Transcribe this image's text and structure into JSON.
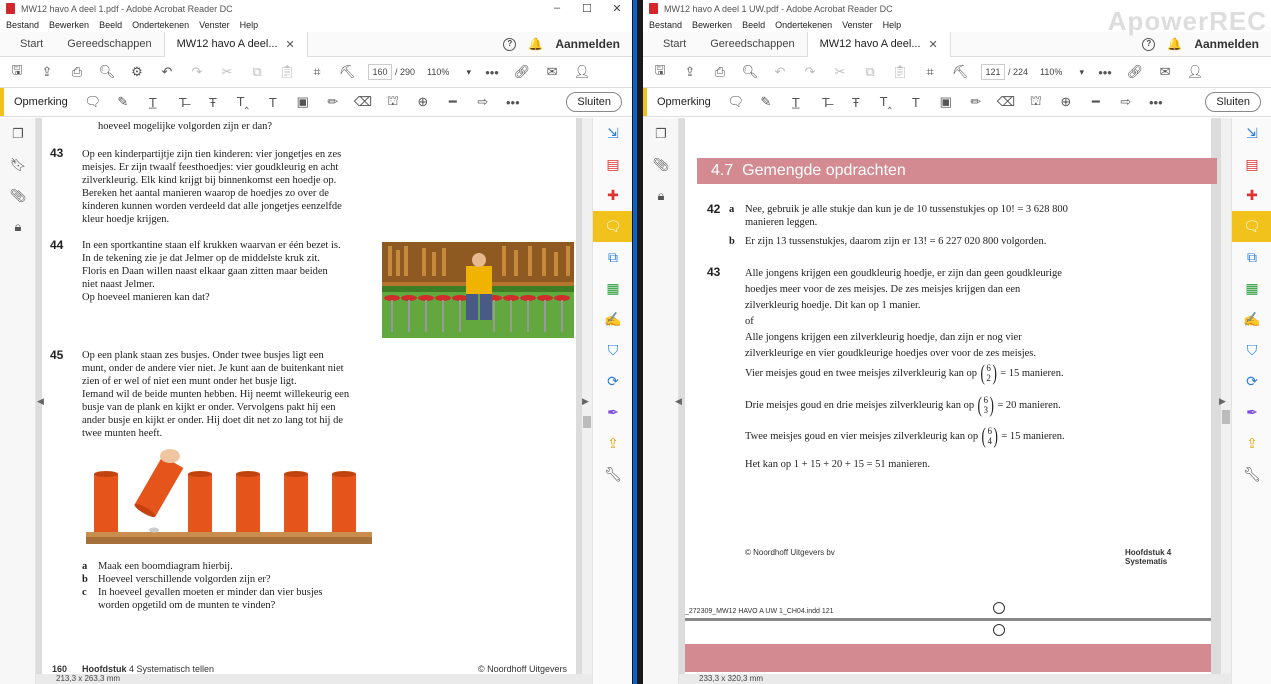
{
  "left": {
    "title": "MW12 havo A deel 1.pdf - Adobe Acrobat Reader DC",
    "menu": [
      "Bestand",
      "Bewerken",
      "Beeld",
      "Ondertekenen",
      "Venster",
      "Help"
    ],
    "tabs": {
      "start": "Start",
      "tools": "Gereedschappen",
      "doc": "MW12 havo A deel..."
    },
    "signin": "Aanmelden",
    "page_current": "160",
    "page_total": "/ 290",
    "zoom": "110%",
    "comment_label": "Opmerking",
    "close_label": "Sluiten",
    "status_size": "213,3 x 263,3 mm",
    "content": {
      "top_cut": "hoeveel mogelijke volgorden zijn er dan?",
      "ex43_num": "43",
      "ex43_lines": [
        "Op een kinderpartijtje zijn tien kinderen: vier jongetjes en zes",
        "meisjes. Er zijn twaalf feesthoedjes: vier goudkleurig en acht",
        "zilverkleurig. Elk kind krijgt bij binnenkomst een hoedje op.",
        "Bereken het aantal manieren waarop de hoedjes zo over de",
        "kinderen kunnen worden verdeeld dat alle jongetjes eenzelfde",
        "kleur hoedje krijgen."
      ],
      "ex44_num": "44",
      "ex44_lines": [
        "In een sportkantine staan elf krukken waarvan er één bezet is.",
        "In de tekening zie je dat Jelmer op de middelste kruk zit.",
        "Floris en Daan willen naast elkaar gaan zitten maar beiden",
        "niet naast Jelmer.",
        "Op hoeveel manieren kan dat?"
      ],
      "ex45_num": "45",
      "ex45_lines": [
        "Op een plank staan zes busjes. Onder twee busjes ligt een",
        "munt, onder de andere vier niet. Je kunt aan de buitenkant niet",
        "zien of er wel of niet een munt onder het busje ligt.",
        "Iemand wil de beide munten hebben. Hij neemt willekeurig een",
        "busje van de plank en kijkt er onder. Vervolgens pakt hij een",
        "ander busje en kijkt er onder. Hij doet dit net zo lang tot hij de",
        "twee munten heeft."
      ],
      "sub_a_letter": "a",
      "sub_a": "Maak een boomdiagram hierbij.",
      "sub_b_letter": "b",
      "sub_b": "Hoeveel verschillende volgorden zijn er?",
      "sub_c_letter": "c",
      "sub_c_1": "In hoeveel gevallen moeten er minder dan vier busjes",
      "sub_c_2": "worden opgetild om de munten te vinden?",
      "footer_page": "160",
      "footer_chapter_bold": "Hoofdstuk",
      "footer_chapter": "4 Systematisch tellen",
      "footer_right": "© Noordhoff Uitgevers bv"
    }
  },
  "right": {
    "title": "MW12 havo A deel 1 UW.pdf - Adobe Acrobat Reader DC",
    "menu": [
      "Bestand",
      "Bewerken",
      "Beeld",
      "Ondertekenen",
      "Venster",
      "Help"
    ],
    "tabs": {
      "start": "Start",
      "tools": "Gereedschappen",
      "doc": "MW12 havo A deel..."
    },
    "signin": "Aanmelden",
    "watermark": "ApowerREC",
    "page_current": "121",
    "page_total": "/ 224",
    "zoom": "110%",
    "comment_label": "Opmerking",
    "close_label": "Sluiten",
    "status_size": "233,3 x 320,3 mm",
    "content": {
      "section_num": "4.7",
      "section_title": "Gemengde opdrachten",
      "ex42_num": "42",
      "ex42a_letter": "a",
      "ex42a_1": "Nee, gebruik je alle stukje dan kun je de 10 tussenstukjes op 10! = 3 628 800",
      "ex42a_2": "manieren leggen.",
      "ex42b_letter": "b",
      "ex42b": "Er zijn 13 tussenstukjes, daarom zijn er 13! = 6 227 020 800 volgorden.",
      "ex43_num": "43",
      "ex43_lines": [
        "Alle jongens krijgen een goudkleurig hoedje, er zijn dan geen goudkleurige",
        "hoedjes meer voor de zes meisjes. De zes meisjes krijgen dan een",
        "zilverkleurig hoedje. Dit kan op 1 manier.",
        "of",
        "Alle jongens krijgen een zilverkleurig hoedje, dan zijn er nog vier",
        "zilverkleurige en vier goudkleurige hoedjes over voor de zes meisjes."
      ],
      "calc1_text": "Vier meisjes goud en twee meisjes zilverkleurig kan op",
      "calc1_n": "6",
      "calc1_k": "2",
      "calc1_result": "= 15 manieren.",
      "calc2_text": "Drie meisjes goud en drie meisjes zilverkleurig kan op",
      "calc2_n": "6",
      "calc2_k": "3",
      "calc2_result": "= 20 manieren.",
      "calc3_text": "Twee meisjes goud en vier meisjes zilverkleurig kan op",
      "calc3_n": "6",
      "calc3_k": "4",
      "calc3_result": "= 15 manieren.",
      "total": "Het kan op 1 + 15 + 20 + 15 = 51 manieren.",
      "footer_left": "© Noordhoff Uitgevers bv",
      "footer_right": "Hoofdstuk 4 Systematis",
      "print_info": "_272309_MW12 HAVO A UW 1_CH04.indd   121"
    }
  }
}
